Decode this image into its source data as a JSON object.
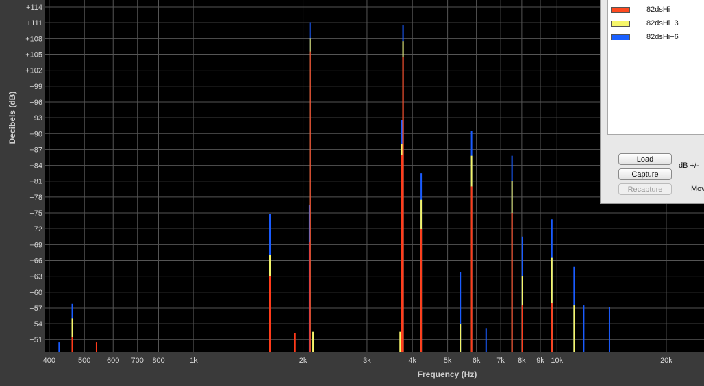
{
  "chart_data": {
    "type": "bar",
    "xlabel": "Frequency (Hz)",
    "ylabel": "Decibels (dB)",
    "xscale": "log",
    "xlim": [
      390,
      25400
    ],
    "ylim": [
      48.7,
      115.3
    ],
    "grid": true,
    "legend_position": "top-right",
    "x_ticks": [
      {
        "value": 400,
        "label": "400"
      },
      {
        "value": 500,
        "label": "500"
      },
      {
        "value": 600,
        "label": "600"
      },
      {
        "value": 700,
        "label": "700"
      },
      {
        "value": 800,
        "label": "800"
      },
      {
        "value": 1000,
        "label": "1k"
      },
      {
        "value": 2000,
        "label": "2k"
      },
      {
        "value": 3000,
        "label": "3k"
      },
      {
        "value": 4000,
        "label": "4k"
      },
      {
        "value": 5000,
        "label": "5k"
      },
      {
        "value": 6000,
        "label": "6k"
      },
      {
        "value": 7000,
        "label": "7k"
      },
      {
        "value": 8000,
        "label": "8k"
      },
      {
        "value": 9000,
        "label": "9k"
      },
      {
        "value": 10000,
        "label": "10k"
      },
      {
        "value": 20000,
        "label": "20k"
      }
    ],
    "y_ticks": [
      {
        "value": 51,
        "label": "+51"
      },
      {
        "value": 54,
        "label": "+54"
      },
      {
        "value": 57,
        "label": "+57"
      },
      {
        "value": 60,
        "label": "+60"
      },
      {
        "value": 63,
        "label": "+63"
      },
      {
        "value": 66,
        "label": "+66"
      },
      {
        "value": 69,
        "label": "+69"
      },
      {
        "value": 72,
        "label": "+72"
      },
      {
        "value": 75,
        "label": "+75"
      },
      {
        "value": 78,
        "label": "+78"
      },
      {
        "value": 81,
        "label": "+81"
      },
      {
        "value": 84,
        "label": "+84"
      },
      {
        "value": 87,
        "label": "+87"
      },
      {
        "value": 90,
        "label": "+90"
      },
      {
        "value": 93,
        "label": "+93"
      },
      {
        "value": 96,
        "label": "+96"
      },
      {
        "value": 99,
        "label": "+99"
      },
      {
        "value": 102,
        "label": "+102"
      },
      {
        "value": 105,
        "label": "+105"
      },
      {
        "value": 108,
        "label": "+108"
      },
      {
        "value": 111,
        "label": "+111"
      },
      {
        "value": 114,
        "label": "+114"
      }
    ],
    "series": [
      {
        "name": "82dsHi+6",
        "color": "#1a5cff",
        "points": [
          {
            "x": 463,
            "y": 57.8
          },
          {
            "x": 1620,
            "y": 74.8
          },
          {
            "x": 2083,
            "y": 76.5
          },
          {
            "x": 2090,
            "y": 111.1
          },
          {
            "x": 3740,
            "y": 92.5
          },
          {
            "x": 3770,
            "y": 110.5
          },
          {
            "x": 4230,
            "y": 82.5
          },
          {
            "x": 5420,
            "y": 63.8
          },
          {
            "x": 5820,
            "y": 90.5
          },
          {
            "x": 6380,
            "y": 53.2
          },
          {
            "x": 7520,
            "y": 85.8
          },
          {
            "x": 8030,
            "y": 70.5
          },
          {
            "x": 9680,
            "y": 73.8
          },
          {
            "x": 11150,
            "y": 64.8
          },
          {
            "x": 11850,
            "y": 57.5
          },
          {
            "x": 13950,
            "y": 57.2
          },
          {
            "x": 426,
            "y": 50.5
          }
        ]
      },
      {
        "name": "82dsHi+3",
        "color": "#f4f46a",
        "points": [
          {
            "x": 463,
            "y": 55.0
          },
          {
            "x": 1620,
            "y": 67.0
          },
          {
            "x": 2090,
            "y": 108.0
          },
          {
            "x": 3740,
            "y": 88.0
          },
          {
            "x": 3770,
            "y": 107.5
          },
          {
            "x": 4230,
            "y": 77.5
          },
          {
            "x": 5420,
            "y": 54.0
          },
          {
            "x": 5820,
            "y": 85.8
          },
          {
            "x": 7520,
            "y": 81.0
          },
          {
            "x": 8030,
            "y": 63.0
          },
          {
            "x": 9680,
            "y": 66.5
          },
          {
            "x": 11150,
            "y": 57.5
          },
          {
            "x": 2130,
            "y": 52.5
          },
          {
            "x": 3700,
            "y": 52.5
          }
        ]
      },
      {
        "name": "82dsHi",
        "color": "#ff3a1a",
        "points": [
          {
            "x": 463,
            "y": 51.5
          },
          {
            "x": 540,
            "y": 50.5
          },
          {
            "x": 1620,
            "y": 63.0
          },
          {
            "x": 1900,
            "y": 52.3
          },
          {
            "x": 2090,
            "y": 105.5
          },
          {
            "x": 3740,
            "y": 86.0
          },
          {
            "x": 3770,
            "y": 104.5
          },
          {
            "x": 4230,
            "y": 72.0
          },
          {
            "x": 5820,
            "y": 80.0
          },
          {
            "x": 7520,
            "y": 75.0
          },
          {
            "x": 8030,
            "y": 57.5
          },
          {
            "x": 9680,
            "y": 58.0
          },
          {
            "x": 2085,
            "y": 69.5
          }
        ]
      }
    ]
  },
  "panel": {
    "legend_items": [
      {
        "label": "82dsHi",
        "color": "#ff4a20"
      },
      {
        "label": "82dsHi+3",
        "color": "#f6f66a"
      },
      {
        "label": "82dsHi+6",
        "color": "#1a60ff"
      }
    ],
    "buttons": {
      "load": "Load",
      "capture": "Capture",
      "recapture": "Recapture"
    },
    "db_label": "dB +/-",
    "move_label": "Mov"
  }
}
